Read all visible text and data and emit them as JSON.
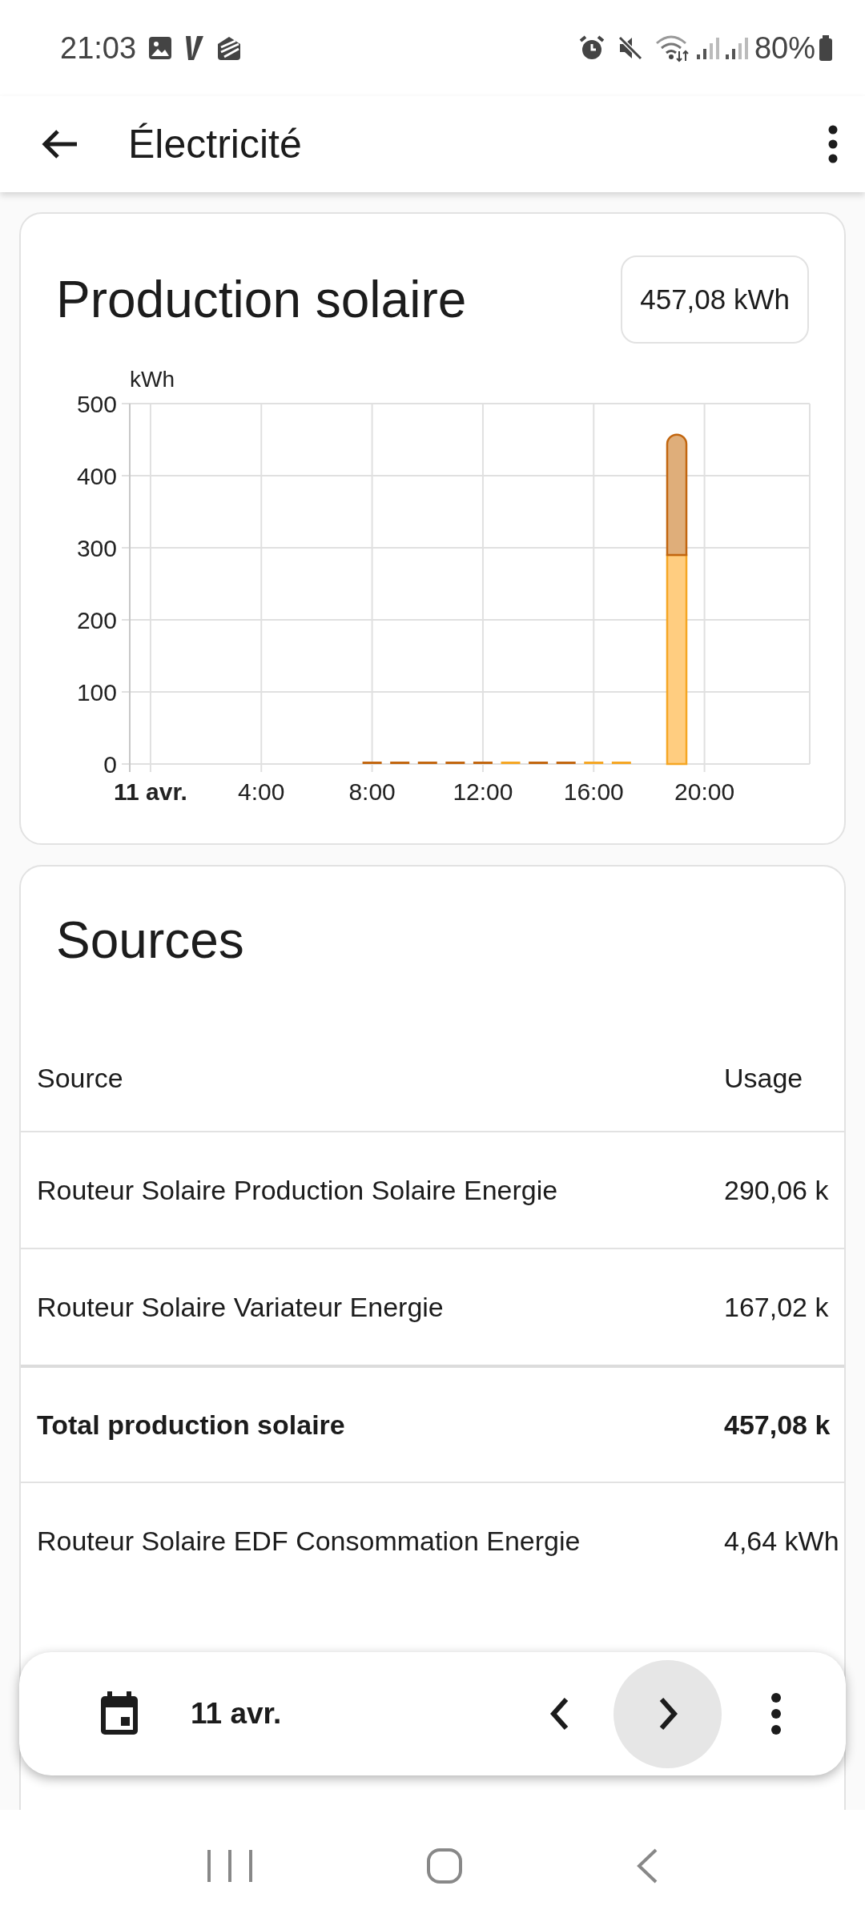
{
  "status_bar": {
    "time": "21:03",
    "battery": "80%"
  },
  "app_bar": {
    "title": "Électricité"
  },
  "production_card": {
    "title": "Production solaire",
    "total": "457,08 kWh",
    "axis_start_date": "11 avr.",
    "chart_data": {
      "type": "bar",
      "ylabel": "kWh",
      "stacked": true,
      "x": [
        8,
        9,
        10,
        11,
        12,
        13,
        14,
        15,
        16,
        17,
        19
      ],
      "series": [
        {
          "color": "#f5a623",
          "values": [
            null,
            null,
            null,
            null,
            null,
            0,
            null,
            null,
            0,
            0,
            290
          ]
        },
        {
          "color": "#c2660f",
          "values": [
            0,
            0,
            0,
            0,
            0,
            null,
            0,
            0,
            null,
            null,
            167
          ]
        }
      ],
      "xlim": [
        -0.75,
        23.8
      ],
      "ylim": [
        0,
        500
      ],
      "grid": true,
      "xticks": [
        {
          "value": 4,
          "label": "4:00"
        },
        {
          "value": 8,
          "label": "8:00"
        },
        {
          "value": 12,
          "label": "12:00"
        },
        {
          "value": 16,
          "label": "16:00"
        },
        {
          "value": 20,
          "label": "20:00"
        }
      ],
      "yticks": [
        0,
        100,
        200,
        300,
        400,
        500
      ]
    }
  },
  "sources_card": {
    "title": "Sources",
    "table": {
      "columns": [
        "Source",
        "Usage"
      ],
      "rows": [
        {
          "kind": "normal",
          "source": "Routeur Solaire Production Solaire Energie",
          "usage": "290,06 k"
        },
        {
          "kind": "normal",
          "source": "Routeur Solaire Variateur Energie",
          "usage": "167,02 k"
        },
        {
          "kind": "total",
          "source": "Total production solaire",
          "usage": "457,08 k"
        },
        {
          "kind": "normal",
          "source": "Routeur Solaire EDF Consommation Energie",
          "usage": "4,64 kWh"
        }
      ]
    }
  },
  "date_bar": {
    "date": "11 avr.",
    "next_highlighted": true
  }
}
